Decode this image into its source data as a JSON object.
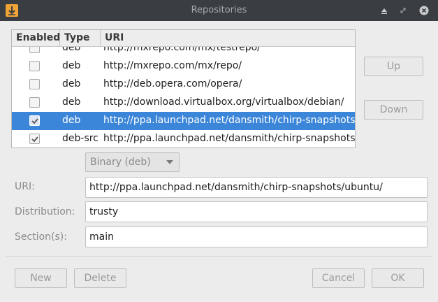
{
  "window": {
    "title": "Repositories",
    "titlebar_color": "#3a3d41",
    "app_icon": "download-arrow-icon",
    "controls": [
      "shade-icon",
      "maximize-icon",
      "close-icon"
    ]
  },
  "table": {
    "headers": [
      "Enabled",
      "Type",
      "URI"
    ],
    "rows": [
      {
        "enabled": false,
        "type": "deb",
        "uri": "http://mxrepo.com/mx/testrepo/"
      },
      {
        "enabled": false,
        "type": "deb",
        "uri": "http://mxrepo.com/mx/repo/"
      },
      {
        "enabled": false,
        "type": "deb",
        "uri": "http://deb.opera.com/opera/"
      },
      {
        "enabled": false,
        "type": "deb",
        "uri": "http://download.virtualbox.org/virtualbox/debian/"
      },
      {
        "enabled": true,
        "type": "deb",
        "uri": "http://ppa.launchpad.net/dansmith/chirp-snapshots/ubuntu/",
        "selected": true
      },
      {
        "enabled": true,
        "type": "deb-src",
        "uri": "http://ppa.launchpad.net/dansmith/chirp-snapshots/ubuntu/"
      }
    ],
    "selection_color": "#3b86d9"
  },
  "side_buttons": {
    "up": "Up",
    "down": "Down"
  },
  "type_combo": {
    "value": "Binary (deb)"
  },
  "form": {
    "uri_label": "URI:",
    "uri_value": "http://ppa.launchpad.net/dansmith/chirp-snapshots/ubuntu/",
    "distribution_label": "Distribution:",
    "distribution_value": "trusty",
    "sections_label": "Section(s):",
    "sections_value": "main"
  },
  "footer": {
    "new": "New",
    "delete": "Delete",
    "cancel": "Cancel",
    "ok": "OK"
  }
}
